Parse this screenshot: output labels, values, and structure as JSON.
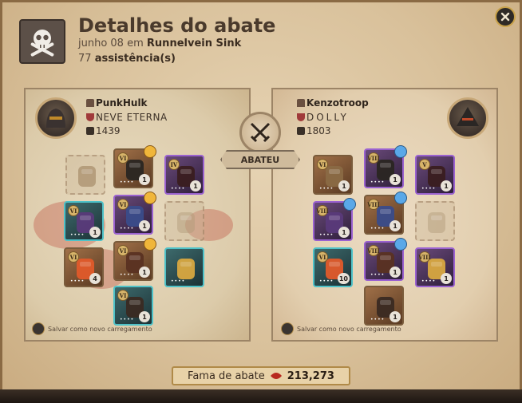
{
  "header": {
    "title": "Detalhes do abate",
    "date": "junho 08",
    "date_prep": "em",
    "location": "Runnelvein Sink",
    "assist_count": "77",
    "assist_label": "assistência(s)"
  },
  "killer": {
    "name": "PunkHulk",
    "guild": "NEVE ETERNA",
    "ip": "1439",
    "save_label": "Salvar como novo carregamento",
    "items": [
      {
        "slot": "bag",
        "tier": "",
        "qty": "",
        "empty": true
      },
      {
        "slot": "head",
        "tier": "VI",
        "qty": "1",
        "ench": "gold",
        "border": "brown"
      },
      {
        "slot": "cape",
        "tier": "IV",
        "qty": "1",
        "border": "purple"
      },
      {
        "slot": "weapon",
        "tier": "VI",
        "qty": "1",
        "border": "teal"
      },
      {
        "slot": "chest",
        "tier": "VI",
        "qty": "1",
        "ench": "gold",
        "border": "purple"
      },
      {
        "slot": "offhand",
        "tier": "",
        "qty": "",
        "empty": true
      },
      {
        "slot": "potion",
        "tier": "VI",
        "qty": "4",
        "border": "brown"
      },
      {
        "slot": "boots",
        "tier": "VI",
        "qty": "1",
        "ench": "gold",
        "border": "brown"
      },
      {
        "slot": "food",
        "tier": "",
        "qty": "",
        "border": "teal"
      },
      {
        "slot": "mount",
        "tier": "VI",
        "qty": "1",
        "border": "teal"
      }
    ]
  },
  "victim": {
    "name": "Kenzotroop",
    "guild": "DOLLY",
    "ip": "1803",
    "save_label": "Salvar como novo carregamento",
    "items": [
      {
        "slot": "bag",
        "tier": "VI",
        "qty": "1",
        "border": "brown"
      },
      {
        "slot": "head",
        "tier": "VIII",
        "qty": "1",
        "ench": "blue",
        "border": "purple"
      },
      {
        "slot": "cape",
        "tier": "V",
        "qty": "1",
        "border": "purple"
      },
      {
        "slot": "weapon",
        "tier": "VIII",
        "qty": "1",
        "ench": "blue",
        "border": "purple"
      },
      {
        "slot": "chest",
        "tier": "VIII",
        "qty": "1",
        "ench": "blue",
        "border": "brown"
      },
      {
        "slot": "offhand",
        "tier": "",
        "qty": "",
        "empty": true
      },
      {
        "slot": "potion",
        "tier": "VI",
        "qty": "10",
        "border": "teal"
      },
      {
        "slot": "boots",
        "tier": "VIII",
        "qty": "1",
        "ench": "blue",
        "border": "purple"
      },
      {
        "slot": "food",
        "tier": "VIII",
        "qty": "1",
        "border": "purple"
      },
      {
        "slot": "mount",
        "tier": "",
        "qty": "1",
        "border": "brown"
      }
    ]
  },
  "vs_label": "ABATEU",
  "fame": {
    "label": "Fama de abate",
    "value": "213,273"
  },
  "colors": {
    "accent": "#c9a24a",
    "parchment": "#e2ceae",
    "purple_border": "#9a62d0",
    "teal_border": "#4ec2c8"
  }
}
